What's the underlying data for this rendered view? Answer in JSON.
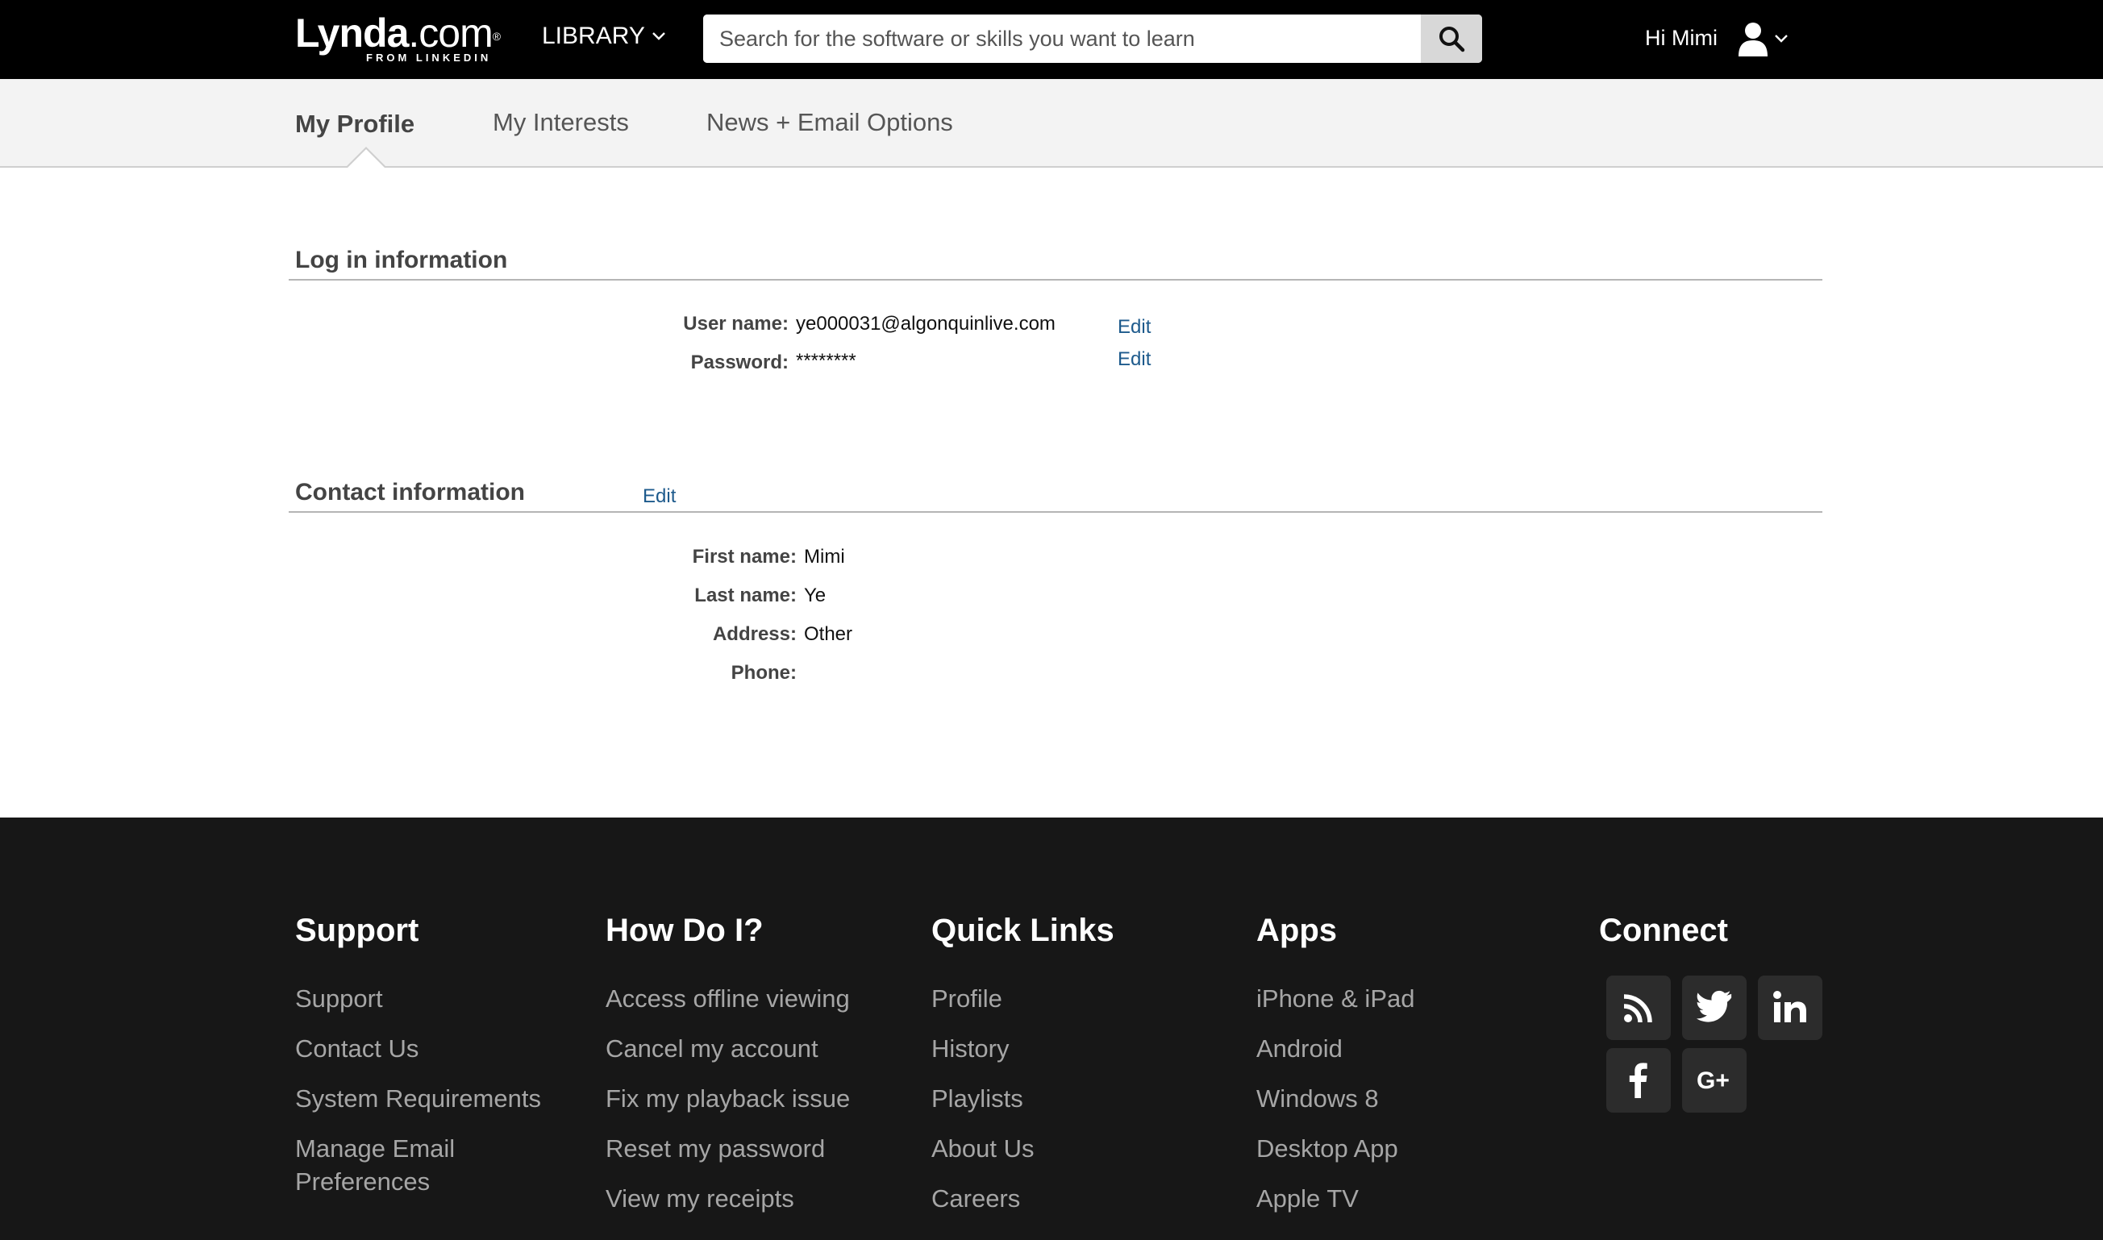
{
  "header": {
    "logo_text_bold": "Lynda",
    "logo_text_rest": ".com",
    "logo_sub": "FROM LINKEDIN",
    "library_label": "LIBRARY",
    "search_placeholder": "Search for the software or skills you want to learn",
    "greeting": "Hi Mimi"
  },
  "tabs": [
    {
      "label": "My Profile",
      "active": true
    },
    {
      "label": "My Interests",
      "active": false
    },
    {
      "label": "News + Email Options",
      "active": false
    }
  ],
  "login": {
    "title": "Log in information",
    "username_label": "User name:",
    "username_value": "ye000031@algonquinlive.com",
    "password_label": "Password:",
    "password_value": "********",
    "edit_label": "Edit"
  },
  "contact": {
    "title": "Contact information",
    "edit_label": "Edit",
    "fields": [
      {
        "label": "First name:",
        "value": "Mimi"
      },
      {
        "label": "Last name:",
        "value": "Ye"
      },
      {
        "label": "Address:",
        "value": "Other"
      },
      {
        "label": "Phone:",
        "value": ""
      }
    ]
  },
  "footer": {
    "support": {
      "title": "Support",
      "links": [
        "Support",
        "Contact Us",
        "System Requirements",
        "Manage Email",
        "Preferences"
      ]
    },
    "howdoi": {
      "title": "How Do I?",
      "links": [
        "Access offline viewing",
        "Cancel my account",
        "Fix my playback issue",
        "Reset my password",
        "View my receipts"
      ]
    },
    "quick": {
      "title": "Quick Links",
      "links": [
        "Profile",
        "History",
        "Playlists",
        "About Us",
        "Careers"
      ]
    },
    "apps": {
      "title": "Apps",
      "links": [
        "iPhone & iPad",
        "Android",
        "Windows 8",
        "Desktop App",
        "Apple TV"
      ]
    },
    "connect": {
      "title": "Connect",
      "icons": [
        "rss-icon",
        "twitter-icon",
        "linkedin-icon",
        "facebook-icon",
        "google-plus-icon"
      ]
    }
  }
}
